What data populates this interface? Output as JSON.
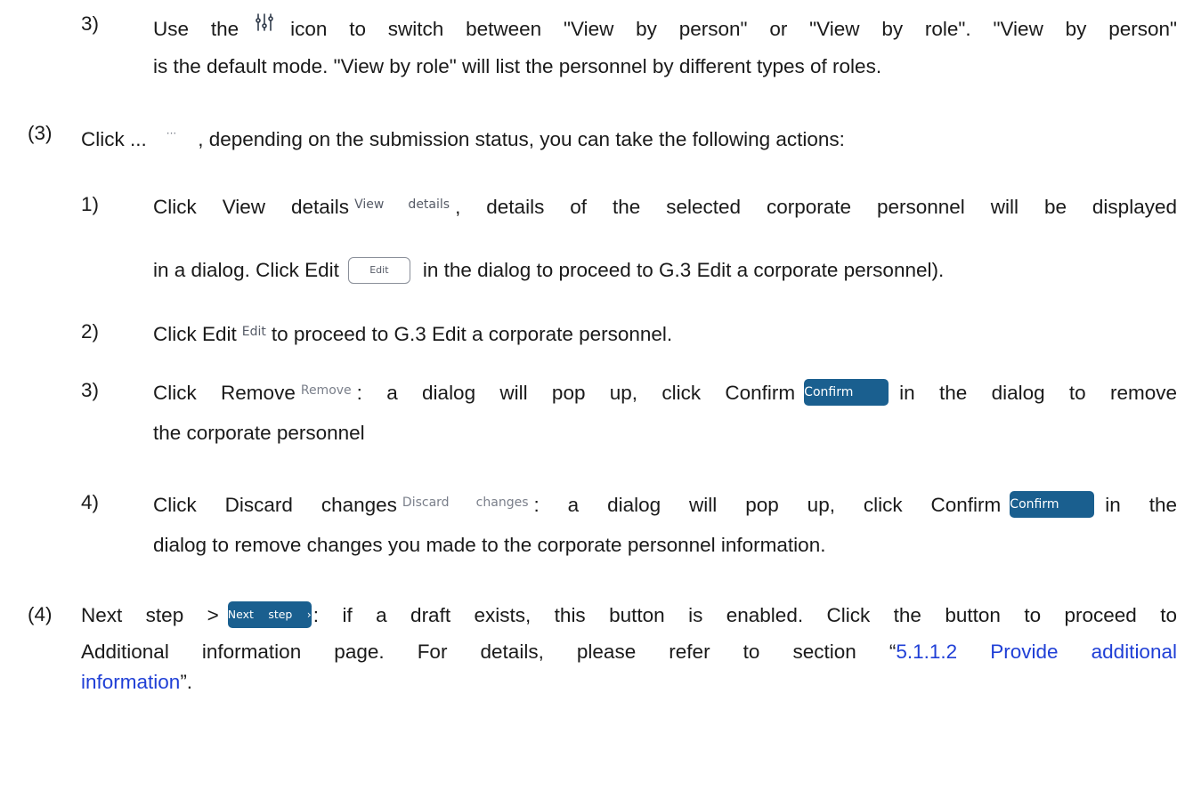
{
  "item_3_sub": {
    "number": "3)",
    "before_icon": "Use the",
    "icon": "filter-sliders-icon",
    "after_icon": "icon to switch between \"View by person\" or \"View by role\". \"View by person\"",
    "line2": "is the default mode. \"View by role\" will list the personnel by different types of roles."
  },
  "step_3": {
    "number": "(3)",
    "before_icon": "Click ...",
    "icon_text": "···",
    "after_icon": ", depending on the submission status, you can take the following actions:"
  },
  "action_1": {
    "number": "1)",
    "before": "Click View details",
    "ui_label": "View details",
    "after": ", details of the selected corporate personnel will be displayed",
    "line2_before": "in a dialog. Click Edit",
    "edit_button": "Edit",
    "line2_after": "in the dialog to proceed to G.3 Edit a corporate personnel)."
  },
  "action_2": {
    "number": "2)",
    "before": "Click Edit",
    "ui_label": "Edit",
    "after": "to proceed to G.3 Edit a corporate personnel."
  },
  "action_3": {
    "number": "3)",
    "before": "Click Remove",
    "ui_label": "Remove",
    "middle": ": a dialog will pop up, click Confirm",
    "confirm_button": "Confirm",
    "after": "in the dialog to remove",
    "line2": "the corporate personnel"
  },
  "action_4": {
    "number": "4)",
    "before": "Click Discard changes",
    "ui_label": "Discard changes",
    "middle": ": a dialog will pop up, click Confirm",
    "confirm_button": "Confirm",
    "after": "in the",
    "line2": "dialog to remove changes you made to the corporate personnel information."
  },
  "step_4": {
    "number": "(4)",
    "before": "Next step >",
    "next_button": "Next step ›",
    "after": ": if a draft exists, this button is enabled. Click the button to proceed to",
    "line2_before": "Additional information page. For details, please refer to section “",
    "link_part1": "5.1.1.2 Provide additional",
    "link_part2": "information",
    "line3_after": "”."
  },
  "colors": {
    "text": "#1a1a1a",
    "link": "#1f3fd6",
    "button_fill": "#1a5f8f",
    "ui_grey": "#7a7f8a"
  }
}
